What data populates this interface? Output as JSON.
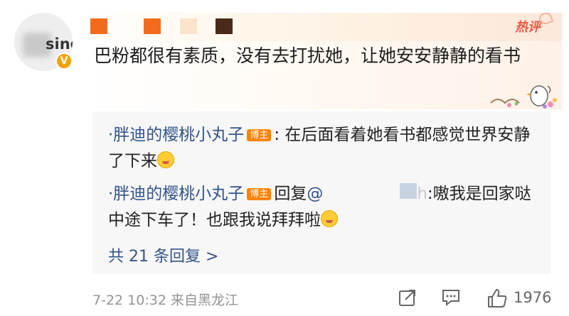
{
  "comment": {
    "username_tail": "sing",
    "verified_badge": "V",
    "hot_label": "热评",
    "text": "巴粉都很有素质，没有去打扰她，让她安安静静的看书",
    "name_colors": [
      "#f26b1c",
      "#f26b1c",
      "#fbe3cc",
      "#4a2a1a"
    ]
  },
  "replies": [
    {
      "username": "·胖迪的樱桃小丸子",
      "badge": "博主",
      "prefix": ":",
      "text": "在后面看着她看书都感觉世界安静了下来"
    },
    {
      "username": "·胖迪的樱桃小丸子",
      "badge": "博主",
      "action": "回复",
      "mention": "@",
      "mention_tail": "h",
      "text": ":嗷我是回家哒中途下车了！也跟我说拜拜啦"
    }
  ],
  "more_replies": "共 21 条回复 >",
  "footer": {
    "time_location": "7-22 10:32 来自黑龙江",
    "like_count": "1976"
  },
  "icons": [
    "repost-icon",
    "comment-icon",
    "like-icon",
    "verified-icon",
    "emoji-icon"
  ]
}
